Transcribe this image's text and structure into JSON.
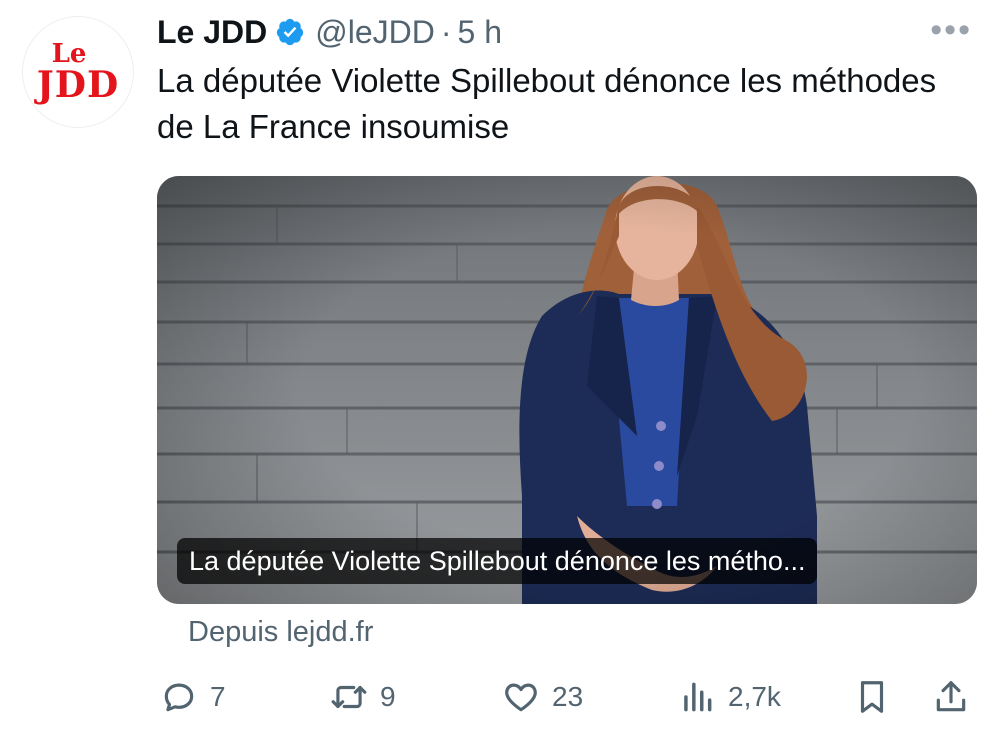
{
  "account": {
    "avatar_line1": "Le",
    "avatar_line2": "JDD",
    "name": "Le JDD",
    "handle": "@leJDD",
    "separator": "·",
    "time": "5 h",
    "verified": true
  },
  "tweet": {
    "text": "La députée Violette Spillebout dénonce les méthodes de La France insoumise",
    "media_caption": "La députée Violette Spillebout dénonce les métho...",
    "source": "Depuis lejdd.fr"
  },
  "actions": {
    "replies": "7",
    "retweets": "9",
    "likes": "23",
    "views": "2,7k"
  },
  "icons": {
    "more": "more-horizontal-icon",
    "verified": "verified-badge-icon",
    "reply": "reply-icon",
    "retweet": "retweet-icon",
    "like": "heart-icon",
    "views": "views-chart-icon",
    "bookmark": "bookmark-icon",
    "share": "share-icon"
  },
  "colors": {
    "brand_red": "#e3141b",
    "verified_blue": "#1d9bf0",
    "text_primary": "#0f1419",
    "text_secondary": "#536471"
  }
}
